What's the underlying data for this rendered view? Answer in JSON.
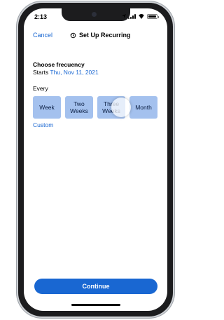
{
  "status_bar": {
    "time": "2:13",
    "icons": [
      "location-icon",
      "signal-icon",
      "wifi-icon",
      "battery-icon"
    ]
  },
  "nav": {
    "cancel_label": "Cancel",
    "title": "Set Up Recurring",
    "title_icon": "recurring-icon"
  },
  "content": {
    "heading": "Choose frecuency",
    "starts_label": "Starts",
    "starts_date": "Thu, Nov 11, 2021",
    "every_label": "Every",
    "options": [
      {
        "line1": "Week",
        "line2": ""
      },
      {
        "line1": "Two",
        "line2": "Weeks"
      },
      {
        "line1": "Three",
        "line2": "Weeks"
      },
      {
        "line1": "Month",
        "line2": ""
      }
    ],
    "custom_label": "Custom"
  },
  "footer": {
    "continue_label": "Continue"
  },
  "colors": {
    "accent": "#1967d2",
    "option_bg": "#a4c1ee",
    "phone_frame": "#1c1c1e"
  }
}
